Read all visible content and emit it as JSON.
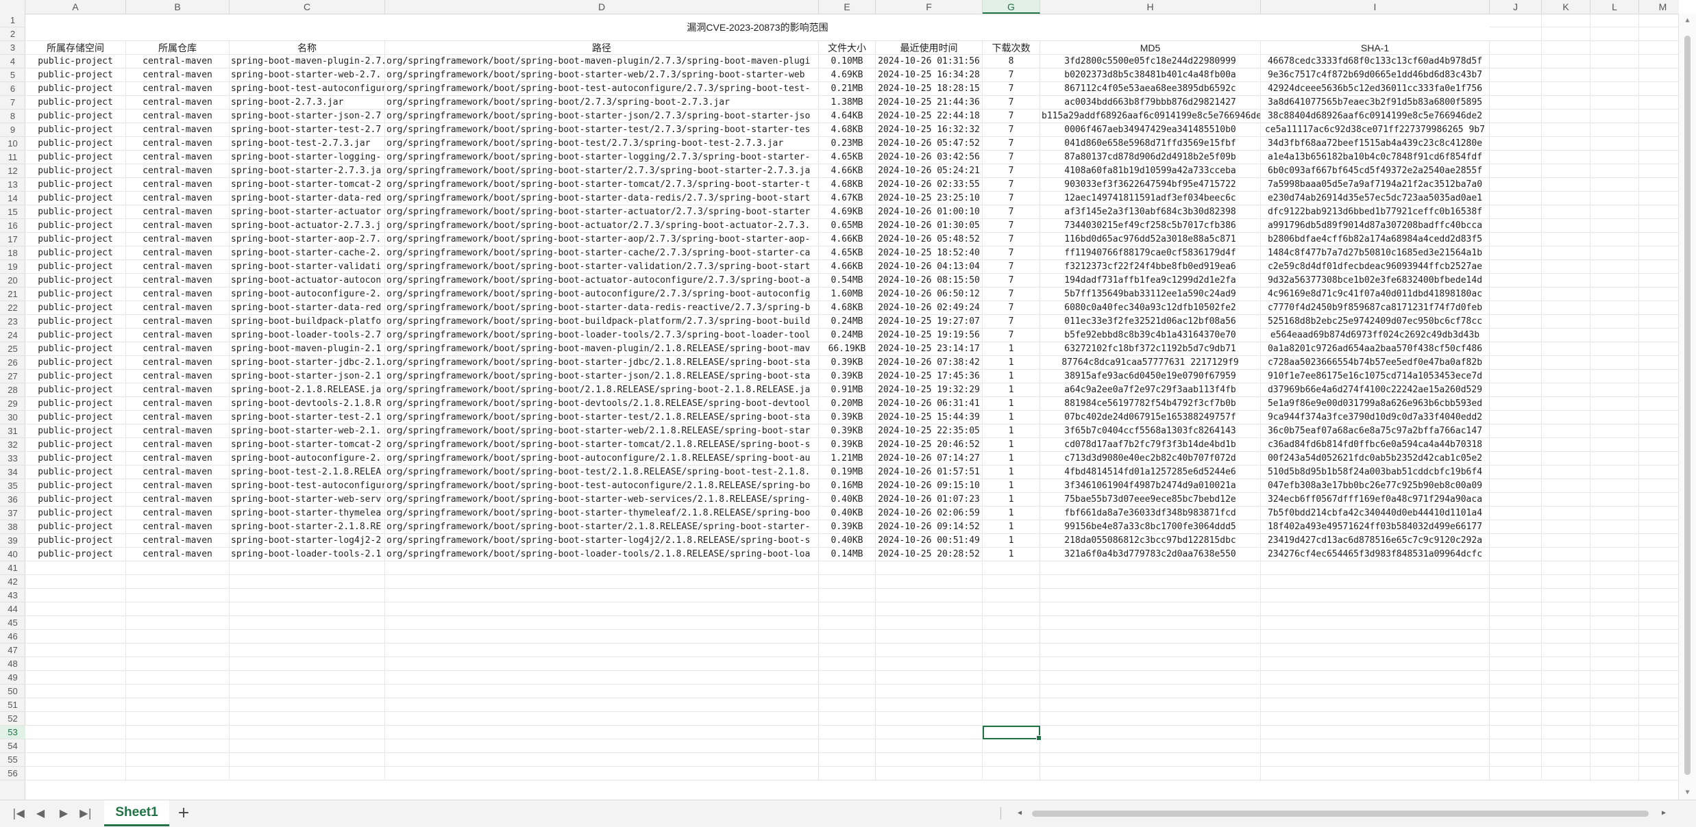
{
  "columns": [
    "A",
    "B",
    "C",
    "D",
    "E",
    "F",
    "G",
    "H",
    "I",
    "J",
    "K",
    "L",
    "M"
  ],
  "selected_column": "G",
  "title": "漏洞CVE-2023-20873的影响范围",
  "headers": [
    "所属存储空间",
    "所属仓库",
    "名称",
    "路径",
    "文件大小",
    "最近使用时间",
    "下载次数",
    "MD5",
    "SHA-1"
  ],
  "rows": [
    [
      "public-project",
      "central-maven",
      "spring-boot-maven-plugin-2.7.",
      "org/springframework/boot/spring-boot-maven-plugin/2.7.3/spring-boot-maven-plugi",
      "0.10MB",
      "2024-10-26 01:31:56",
      "8",
      "3fd2800c5500e05fc18e244d22980999",
      "46678cedc3333fd68f0c133c13cf60ad4b978d5f"
    ],
    [
      "public-project",
      "central-maven",
      "spring-boot-starter-web-2.7.",
      "org/springframework/boot/spring-boot-starter-web/2.7.3/spring-boot-starter-web",
      "4.69KB",
      "2024-10-25 16:34:28",
      "7",
      "b0202373d8b5c38481b401c4a48fb00a",
      "9e36c7517c4f872b69d0665e1dd46bd6d83c43b7"
    ],
    [
      "public-project",
      "central-maven",
      "spring-boot-test-autoconfigur",
      "org/springframework/boot/spring-boot-test-autoconfigure/2.7.3/spring-boot-test-",
      "0.21MB",
      "2024-10-25 18:28:15",
      "7",
      "867112c4f05e53aea68ee3895db6592c",
      "42924dceee5636b5c12ed36011cc333fa0e1f756"
    ],
    [
      "public-project",
      "central-maven",
      "spring-boot-2.7.3.jar",
      "org/springframework/boot/spring-boot/2.7.3/spring-boot-2.7.3.jar",
      "1.38MB",
      "2024-10-25 21:44:36",
      "7",
      "ac0034bdd663b8f79bbb876d29821427",
      "3a8d641077565b7eaec3b2f91d5b83a6800f5895"
    ],
    [
      "public-project",
      "central-maven",
      "spring-boot-starter-json-2.7",
      "org/springframework/boot/spring-boot-starter-json/2.7.3/spring-boot-starter-jso",
      "4.64KB",
      "2024-10-25 22:44:18",
      "7",
      "b115a29addf68926aaf6c0914199e8c5e766946de2",
      "38c88404d68926aaf6c0914199e8c5e766946de2"
    ],
    [
      "public-project",
      "central-maven",
      "spring-boot-starter-test-2.7",
      "org/springframework/boot/spring-boot-starter-test/2.7.3/spring-boot-starter-tes",
      "4.68KB",
      "2024-10-25 16:32:32",
      "7",
      "0006f467aeb34947429ea341485510b0",
      "ce5a11117ac6c92d38ce071ff227379986265 9b7"
    ],
    [
      "public-project",
      "central-maven",
      "spring-boot-test-2.7.3.jar",
      "org/springframework/boot/spring-boot-test/2.7.3/spring-boot-test-2.7.3.jar",
      "0.23MB",
      "2024-10-26 05:47:52",
      "7",
      "041d860e658e5968d71ffd3569e15fbf",
      "34d3fbf68aa72beef1515ab4a439c23c8c41280e"
    ],
    [
      "public-project",
      "central-maven",
      "spring-boot-starter-logging-",
      "org/springframework/boot/spring-boot-starter-logging/2.7.3/spring-boot-starter-",
      "4.65KB",
      "2024-10-26 03:42:56",
      "7",
      "87a80137cd878d906d2d4918b2e5f09b",
      "a1e4a13b656182ba10b4c0c7848f91cd6f854fdf"
    ],
    [
      "public-project",
      "central-maven",
      "spring-boot-starter-2.7.3.ja",
      "org/springframework/boot/spring-boot-starter/2.7.3/spring-boot-starter-2.7.3.ja",
      "4.66KB",
      "2024-10-26 05:24:21",
      "7",
      "4108a60fa81b19d10599a42a733cceba",
      "6b0c093af667bf645cd5f49372e2a2540ae2855f"
    ],
    [
      "public-project",
      "central-maven",
      "spring-boot-starter-tomcat-2",
      "org/springframework/boot/spring-boot-starter-tomcat/2.7.3/spring-boot-starter-t",
      "4.68KB",
      "2024-10-26 02:33:55",
      "7",
      "903033ef3f3622647594bf95e4715722",
      "7a5998baaa05d5e7a9af7194a21f2ac3512ba7a0"
    ],
    [
      "public-project",
      "central-maven",
      "spring-boot-starter-data-red",
      "org/springframework/boot/spring-boot-starter-data-redis/2.7.3/spring-boot-start",
      "4.67KB",
      "2024-10-25 23:25:10",
      "7",
      "12aec149741811591adf3ef034beec6c",
      "e230d74ab26914d35e57ec5dc723aa5035ad0ae1"
    ],
    [
      "public-project",
      "central-maven",
      "spring-boot-starter-actuator",
      "org/springframework/boot/spring-boot-starter-actuator/2.7.3/spring-boot-starter",
      "4.69KB",
      "2024-10-26 01:00:10",
      "7",
      "af3f145e2a3f130abf684c3b30d82398",
      "dfc9122bab9213d6bbed1b77921ceffc0b16538f"
    ],
    [
      "public-project",
      "central-maven",
      "spring-boot-actuator-2.7.3.j",
      "org/springframework/boot/spring-boot-actuator/2.7.3/spring-boot-actuator-2.7.3.",
      "0.65MB",
      "2024-10-26 01:30:05",
      "7",
      "7344030215ef49cf258c5b7017cfb386",
      "a991796db5d89f9014d87a307208badffc40bcca"
    ],
    [
      "public-project",
      "central-maven",
      "spring-boot-starter-aop-2.7.",
      "org/springframework/boot/spring-boot-starter-aop/2.7.3/spring-boot-starter-aop-",
      "4.66KB",
      "2024-10-26 05:48:52",
      "7",
      "116bd0d65ac976dd52a3018e88a5c871",
      "b2806bdfae4cff6b82a174a68984a4cedd2d83f5"
    ],
    [
      "public-project",
      "central-maven",
      "spring-boot-starter-cache-2.",
      "org/springframework/boot/spring-boot-starter-cache/2.7.3/spring-boot-starter-ca",
      "4.65KB",
      "2024-10-25 18:52:40",
      "7",
      "ff11940766f88179cae0cf5836179d4f",
      "1484c8f477b7a7d27b50810c1685ed3e21564a1b"
    ],
    [
      "public-project",
      "central-maven",
      "spring-boot-starter-validati",
      "org/springframework/boot/spring-boot-starter-validation/2.7.3/spring-boot-start",
      "4.66KB",
      "2024-10-26 04:13:04",
      "7",
      "f3212373cf22f24f4bbe8fb0ed919ea6",
      "c2e59c8d4df01dfecbdeac96093944ffcb2527ae"
    ],
    [
      "public-project",
      "central-maven",
      "spring-boot-actuator-autocon",
      "org/springframework/boot/spring-boot-actuator-autoconfigure/2.7.3/spring-boot-a",
      "0.54MB",
      "2024-10-26 08:15:50",
      "7",
      "194dadf731affb1fea9c1299d2d1e2fa",
      "9d32a56377308bce1b02e3fe6832400bfbede14d"
    ],
    [
      "public-project",
      "central-maven",
      "spring-boot-autoconfigure-2.",
      "org/springframework/boot/spring-boot-autoconfigure/2.7.3/spring-boot-autoconfig",
      "1.60MB",
      "2024-10-26 06:50:12",
      "7",
      "5b7ff135649bab33112ee1a590c24ad9",
      "4c96169e8d71c9c41f07a40d011dbd41898180ac"
    ],
    [
      "public-project",
      "central-maven",
      "spring-boot-starter-data-red",
      "org/springframework/boot/spring-boot-starter-data-redis-reactive/2.7.3/spring-b",
      "4.68KB",
      "2024-10-26 02:49:24",
      "7",
      "6080c0a40fec340a93c12dfb10502fe2",
      "c7770f4d2450b9f859687ca8171231f74f7d0feb"
    ],
    [
      "public-project",
      "central-maven",
      "spring-boot-buildpack-platfo",
      "org/springframework/boot/spring-boot-buildpack-platform/2.7.3/spring-boot-build",
      "0.24MB",
      "2024-10-25 19:27:07",
      "7",
      "011ec33e3f2fe32521d06ac12bf08a56",
      "525168d8b2ebc25e9742409d07ec950bc6cf78cc"
    ],
    [
      "public-project",
      "central-maven",
      "spring-boot-loader-tools-2.7",
      "org/springframework/boot/spring-boot-loader-tools/2.7.3/spring-boot-loader-tool",
      "0.24MB",
      "2024-10-25 19:19:56",
      "7",
      "b5fe92ebbd8c8b39c4b1a43164370e70",
      "e564eaad69b874d6973ff024c2692c49db3d43b"
    ],
    [
      "public-project",
      "central-maven",
      "spring-boot-maven-plugin-2.1",
      "org/springframework/boot/spring-boot-maven-plugin/2.1.8.RELEASE/spring-boot-mav",
      "66.19KB",
      "2024-10-25 23:14:17",
      "1",
      "63272102fc18bf372c1192b5d7c9db71",
      "0a1a8201c9726ad654aa2baa570f438cf50cf486"
    ],
    [
      "public-project",
      "central-maven",
      "spring-boot-starter-jdbc-2.1.",
      "org/springframework/boot/spring-boot-starter-jdbc/2.1.8.RELEASE/spring-boot-sta",
      "0.39KB",
      "2024-10-26 07:38:42",
      "1",
      "87764c8dca91caa57777631 2217129f9",
      "c728aa5023666554b74b57ee5edf0e47ba0af82b"
    ],
    [
      "public-project",
      "central-maven",
      "spring-boot-starter-json-2.1",
      "org/springframework/boot/spring-boot-starter-json/2.1.8.RELEASE/spring-boot-sta",
      "0.39KB",
      "2024-10-25 17:45:36",
      "1",
      "38915afe93ac6d0450e19e0790f67959",
      "910f1e7ee86175e16c1075cd714a1053453ece7d"
    ],
    [
      "public-project",
      "central-maven",
      "spring-boot-2.1.8.RELEASE.ja",
      "org/springframework/boot/spring-boot/2.1.8.RELEASE/spring-boot-2.1.8.RELEASE.ja",
      "0.91MB",
      "2024-10-25 19:32:29",
      "1",
      "a64c9a2ee0a7f2e97c29f3aab113f4fb",
      "d37969b66e4a6d274f4100c22242ae15a260d529"
    ],
    [
      "public-project",
      "central-maven",
      "spring-boot-devtools-2.1.8.R",
      "org/springframework/boot/spring-boot-devtools/2.1.8.RELEASE/spring-boot-devtool",
      "0.20MB",
      "2024-10-26 06:31:41",
      "1",
      "881984ce56197782f54b4792f3cf7b0b",
      "5e1a9f86e9e00d031799a8a626e963b6cbb593ed"
    ],
    [
      "public-project",
      "central-maven",
      "spring-boot-starter-test-2.1",
      "org/springframework/boot/spring-boot-starter-test/2.1.8.RELEASE/spring-boot-sta",
      "0.39KB",
      "2024-10-25 15:44:39",
      "1",
      "07bc402de24d067915e165388249757f",
      "9ca944f374a3fce3790d10d9c0d7a33f4040edd2"
    ],
    [
      "public-project",
      "central-maven",
      "spring-boot-starter-web-2.1.",
      "org/springframework/boot/spring-boot-starter-web/2.1.8.RELEASE/spring-boot-star",
      "0.39KB",
      "2024-10-25 22:35:05",
      "1",
      "3f65b7c0404ccf5568a1303fc8264143",
      "36c0b75eaf07a68ac6e8a75c97a2bffa766ac147"
    ],
    [
      "public-project",
      "central-maven",
      "spring-boot-starter-tomcat-2",
      "org/springframework/boot/spring-boot-starter-tomcat/2.1.8.RELEASE/spring-boot-s",
      "0.39KB",
      "2024-10-25 20:46:52",
      "1",
      "cd078d17aaf7b2fc79f3f3b14de4bd1b",
      "c36ad84fd6b814fd0ffbc6e0a594ca4a44b70318"
    ],
    [
      "public-project",
      "central-maven",
      "spring-boot-autoconfigure-2.",
      "org/springframework/boot/spring-boot-autoconfigure/2.1.8.RELEASE/spring-boot-au",
      "1.21MB",
      "2024-10-26 07:14:27",
      "1",
      "c713d3d9080e40ec2b82c40b707f072d",
      "00f243a54d052621fdc0ab5b2352d42cab1c05e2"
    ],
    [
      "public-project",
      "central-maven",
      "spring-boot-test-2.1.8.RELEA",
      "org/springframework/boot/spring-boot-test/2.1.8.RELEASE/spring-boot-test-2.1.8.",
      "0.19MB",
      "2024-10-26 01:57:51",
      "1",
      "4fbd4814514fd01a1257285e6d5244e6",
      "510d5b8d95b1b58f24a003bab51cddcbfc19b6f4"
    ],
    [
      "public-project",
      "central-maven",
      "spring-boot-test-autoconfigur",
      "org/springframework/boot/spring-boot-test-autoconfigure/2.1.8.RELEASE/spring-bo",
      "0.16MB",
      "2024-10-26 09:15:10",
      "1",
      "3f3461061904f4987b2474d9a010021a",
      "047efb308a3e17bb0bc26e77c925b90eb8c00a09"
    ],
    [
      "public-project",
      "central-maven",
      "spring-boot-starter-web-serv",
      "org/springframework/boot/spring-boot-starter-web-services/2.1.8.RELEASE/spring-",
      "0.40KB",
      "2024-10-26 01:07:23",
      "1",
      "75bae55b73d07eee9ece85bc7bebd12e",
      "324ecb6ff0567dfff169ef0a48c971f294a90aca"
    ],
    [
      "public-project",
      "central-maven",
      "spring-boot-starter-thymelea",
      "org/springframework/boot/spring-boot-starter-thymeleaf/2.1.8.RELEASE/spring-boo",
      "0.40KB",
      "2024-10-26 02:06:59",
      "1",
      "fbf661da8a7e36033df348b983871fcd",
      "7b5f0bdd214cbfa42c340440d0eb44410d1101a4"
    ],
    [
      "public-project",
      "central-maven",
      "spring-boot-starter-2.1.8.RE",
      "org/springframework/boot/spring-boot-starter/2.1.8.RELEASE/spring-boot-starter-",
      "0.39KB",
      "2024-10-26 09:14:52",
      "1",
      "99156be4e87a33c8bc1700fe3064ddd5",
      "18f402a493e49571624ff03b584032d499e66177"
    ],
    [
      "public-project",
      "central-maven",
      "spring-boot-starter-log4j2-2",
      "org/springframework/boot/spring-boot-starter-log4j2/2.1.8.RELEASE/spring-boot-s",
      "0.40KB",
      "2024-10-26 00:51:49",
      "1",
      "218da055086812c3bcc97bd122815dbc",
      "23419d427cd13ac6d878516e65c7c9c9120c292a"
    ],
    [
      "public-project",
      "central-maven",
      "spring-boot-loader-tools-2.1",
      "org/springframework/boot/spring-boot-loader-tools/2.1.8.RELEASE/spring-boot-loa",
      "0.14MB",
      "2024-10-25 20:28:52",
      "1",
      "321a6f0a4b3d779783c2d0aa7638e550",
      "234276cf4ec654465f3d983f848531a09964dcfc"
    ]
  ],
  "row_numbers": [
    "1",
    "2",
    "3",
    "4",
    "5",
    "6",
    "7",
    "8",
    "9",
    "10",
    "11",
    "12",
    "13",
    "14",
    "15",
    "16",
    "17",
    "18",
    "19",
    "20",
    "21",
    "22",
    "23",
    "24",
    "25",
    "26",
    "27",
    "28",
    "29",
    "30",
    "31",
    "32",
    "33",
    "34",
    "35",
    "36",
    "37",
    "38",
    "39",
    "40",
    "41",
    "42",
    "43",
    "44",
    "45",
    "46",
    "47",
    "48",
    "49",
    "50",
    "51",
    "52",
    "53",
    "54",
    "55",
    "56"
  ],
  "selected_row": "53",
  "sheet_tab": "Sheet1",
  "add_sheet": "+",
  "nav": {
    "first": "|◀",
    "prev": "◀",
    "next": "▶",
    "last": "▶|"
  },
  "colors": {
    "accent": "#217346"
  }
}
